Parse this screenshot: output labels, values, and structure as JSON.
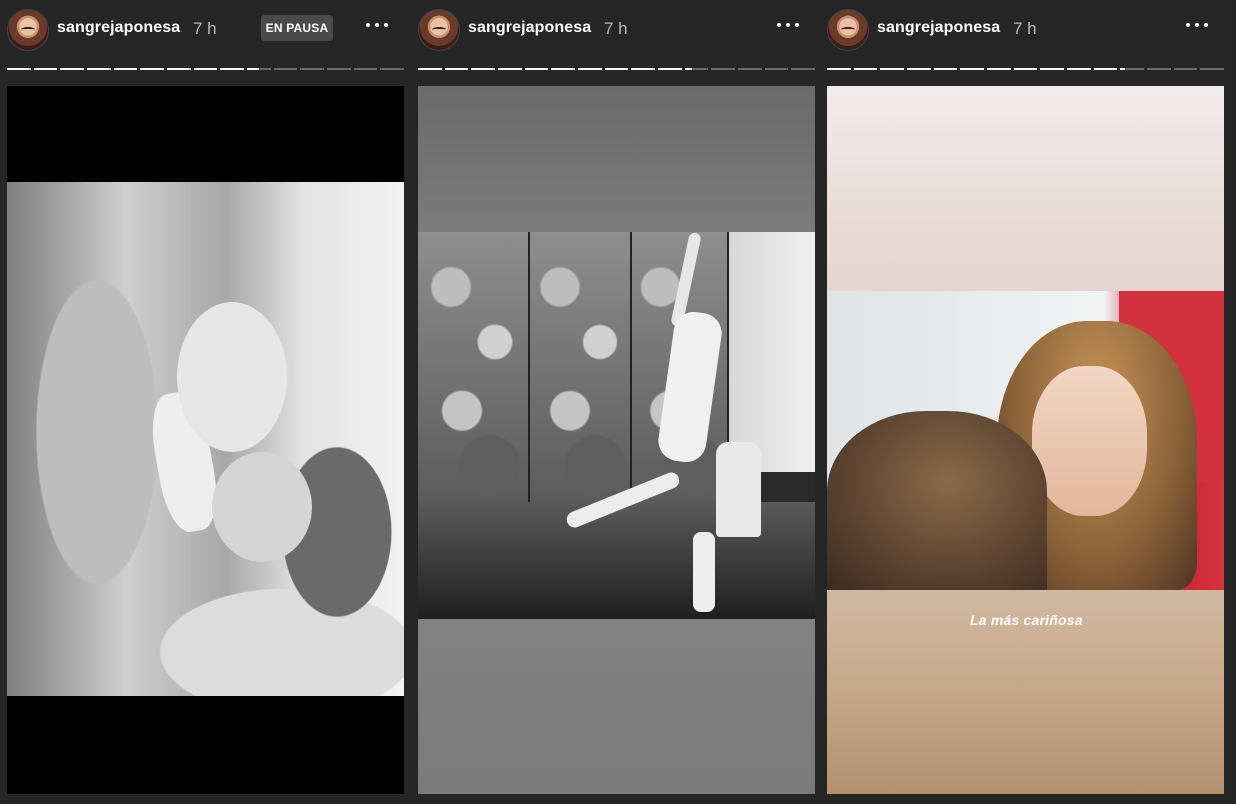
{
  "stories": [
    {
      "username": "sangrejaponesa",
      "time": "7 h",
      "paused_label": "EN PAUSA",
      "progress": {
        "total": 15,
        "done": 9,
        "current_fraction": 0.5
      }
    },
    {
      "username": "sangrejaponesa",
      "time": "7 h",
      "progress": {
        "total": 15,
        "done": 10,
        "current_fraction": 0.3
      }
    },
    {
      "username": "sangrejaponesa",
      "time": "7 h",
      "progress": {
        "total": 15,
        "done": 11,
        "current_fraction": 0.2
      },
      "caption": "La más cariñosa"
    }
  ],
  "icons": {
    "more": "more-horizontal-icon",
    "avatar": "profile-avatar"
  },
  "colors": {
    "background": "#262626",
    "progress_done": "#f2f2f2",
    "progress_pending": "#6a6a6a",
    "paused_badge": "#4a4a4a",
    "time_text": "#b9b9b9"
  }
}
